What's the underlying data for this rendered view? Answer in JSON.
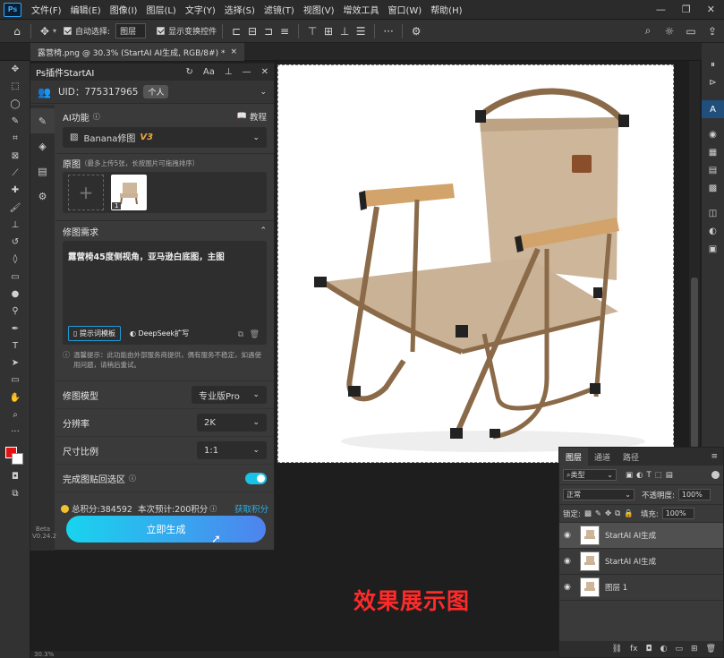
{
  "app": {
    "logo": "Ps"
  },
  "menu": [
    "文件(F)",
    "编辑(E)",
    "图像(I)",
    "图层(L)",
    "文字(Y)",
    "选择(S)",
    "滤镜(T)",
    "视图(V)",
    "增效工具",
    "窗口(W)",
    "帮助(H)"
  ],
  "options": {
    "auto_select_label": "自动选择:",
    "auto_select_value": "图层",
    "show_transform_label": "显示变换控件"
  },
  "document_tab": {
    "title": "露营椅.png @ 30.3% (StartAI AI生成, RGB/8#) *",
    "close": "×"
  },
  "plugin": {
    "title": "Ps插件StartAI",
    "uid_label": "UID：775317965",
    "account_type": "个人",
    "ai_function_label": "AI功能",
    "tutorial_label": "教程",
    "model_name": "Banana修图",
    "model_version": "V3",
    "source_label": "原图",
    "source_hint": "（最多上传5张，长按图片可拖拽排序）",
    "image_badge": "1",
    "requirement_label": "修图需求",
    "prompt_text": "露营椅45度侧视角，亚马逊白底图，主图",
    "template_button": "提示词模板",
    "deepseek_button": "DeepSeek扩写",
    "notice_text": "温馨提示：此功能由外部服务商提供，偶有服务不稳定，如遇使用问题，请稍后重试。",
    "retouch_model_label": "修图模型",
    "retouch_model_value": "专业版Pro",
    "resolution_label": "分辨率",
    "resolution_value": "2K",
    "ratio_label": "尺寸比例",
    "ratio_value": "1:1",
    "paste_back_label": "完成图贴回选区",
    "paste_back_on": true,
    "points_total": "总积分:384592",
    "points_estimate": "本次预计:200积分",
    "get_points": "获取积分",
    "generate_button": "立即生成",
    "beta_label": "Beta",
    "version_label": "V0.24.2"
  },
  "caption": "效果展示图",
  "layers_panel": {
    "tabs": [
      "图层",
      "通道",
      "路径"
    ],
    "filter_label": "类型",
    "blend_mode": "正常",
    "opacity_label": "不透明度:",
    "opacity_value": "100%",
    "lock_label": "锁定:",
    "fill_label": "填充:",
    "fill_value": "100%",
    "layers": [
      {
        "name": "StartAI AI生成",
        "selected": true
      },
      {
        "name": "StartAI AI生成",
        "selected": false
      },
      {
        "name": "图层 1",
        "selected": false
      }
    ]
  },
  "status": {
    "zoom": "30.3%"
  },
  "colors": {
    "accent": "#19c3e6",
    "caption": "#ff2a2a",
    "version_gold": "#e8a93a",
    "link": "#2ab0e8"
  }
}
